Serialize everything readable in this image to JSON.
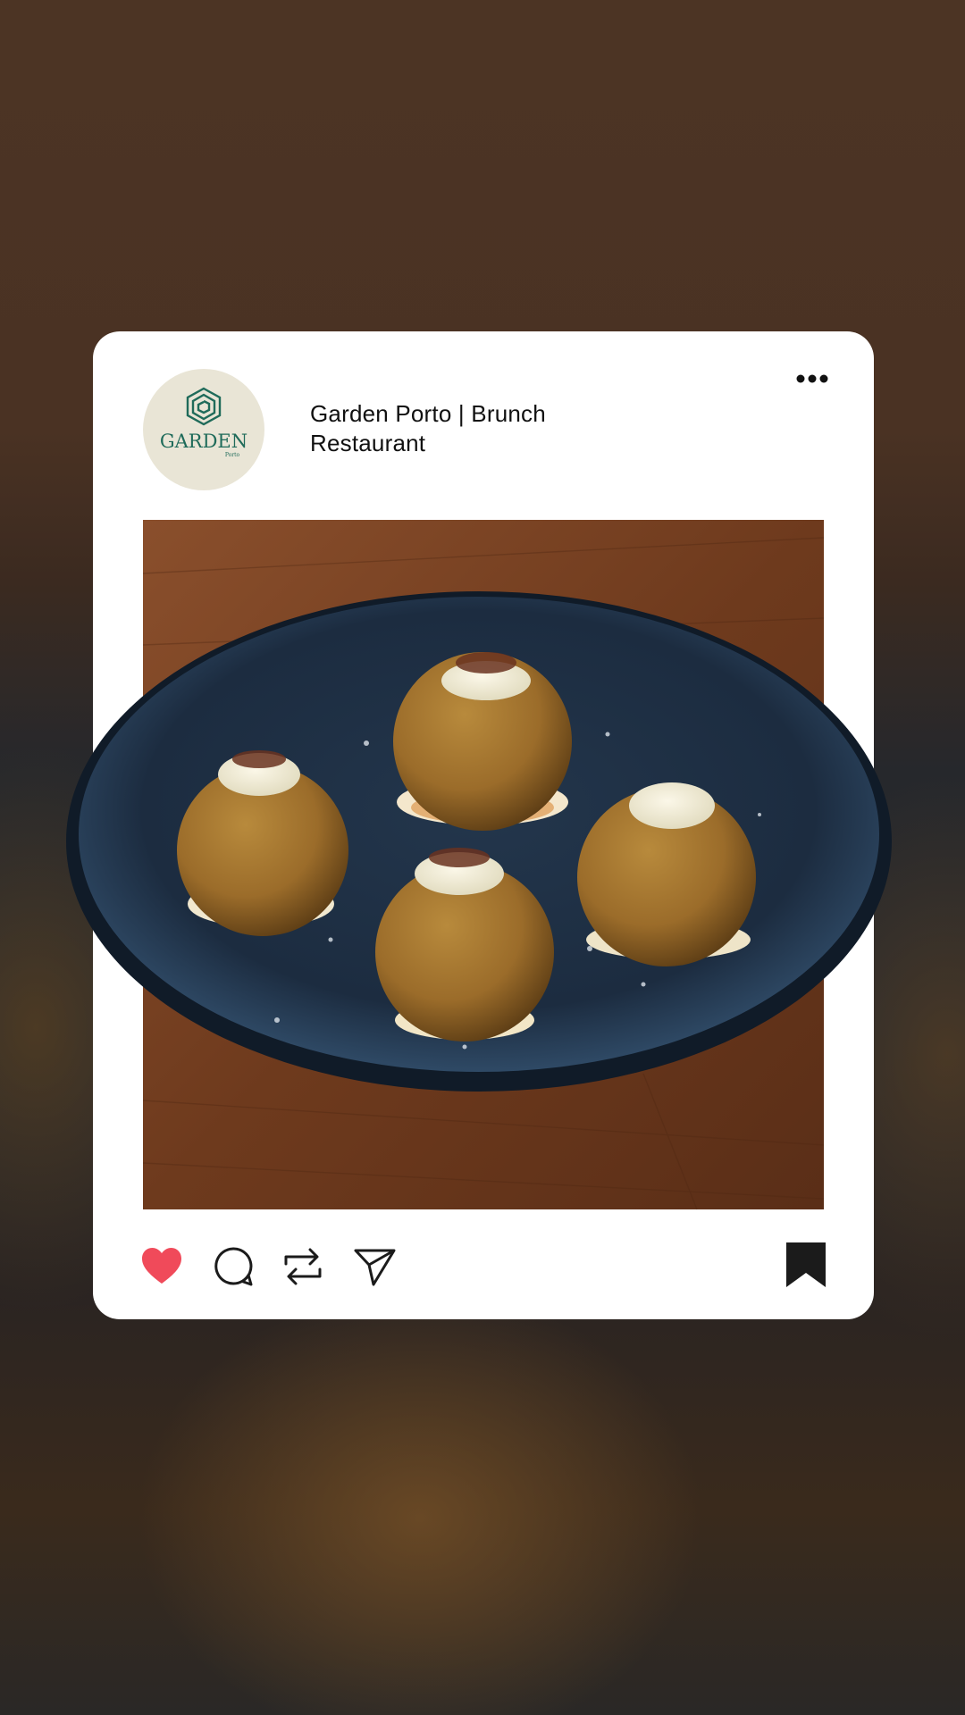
{
  "post": {
    "account_name": "Garden Porto | Brunch Restaurant",
    "avatar_text": "GARDEN",
    "avatar_subtext": "Porto",
    "liked": true
  },
  "colors": {
    "like_red": "#f04a5a",
    "brand_green": "#1f6b5a",
    "card_bg": "#ffffff",
    "icon_dark": "#1b1b1b"
  },
  "icons": {
    "more": "ellipsis-icon",
    "like": "heart-icon",
    "comment": "comment-icon",
    "repost": "repost-icon",
    "share": "send-icon",
    "save": "bookmark-icon"
  }
}
